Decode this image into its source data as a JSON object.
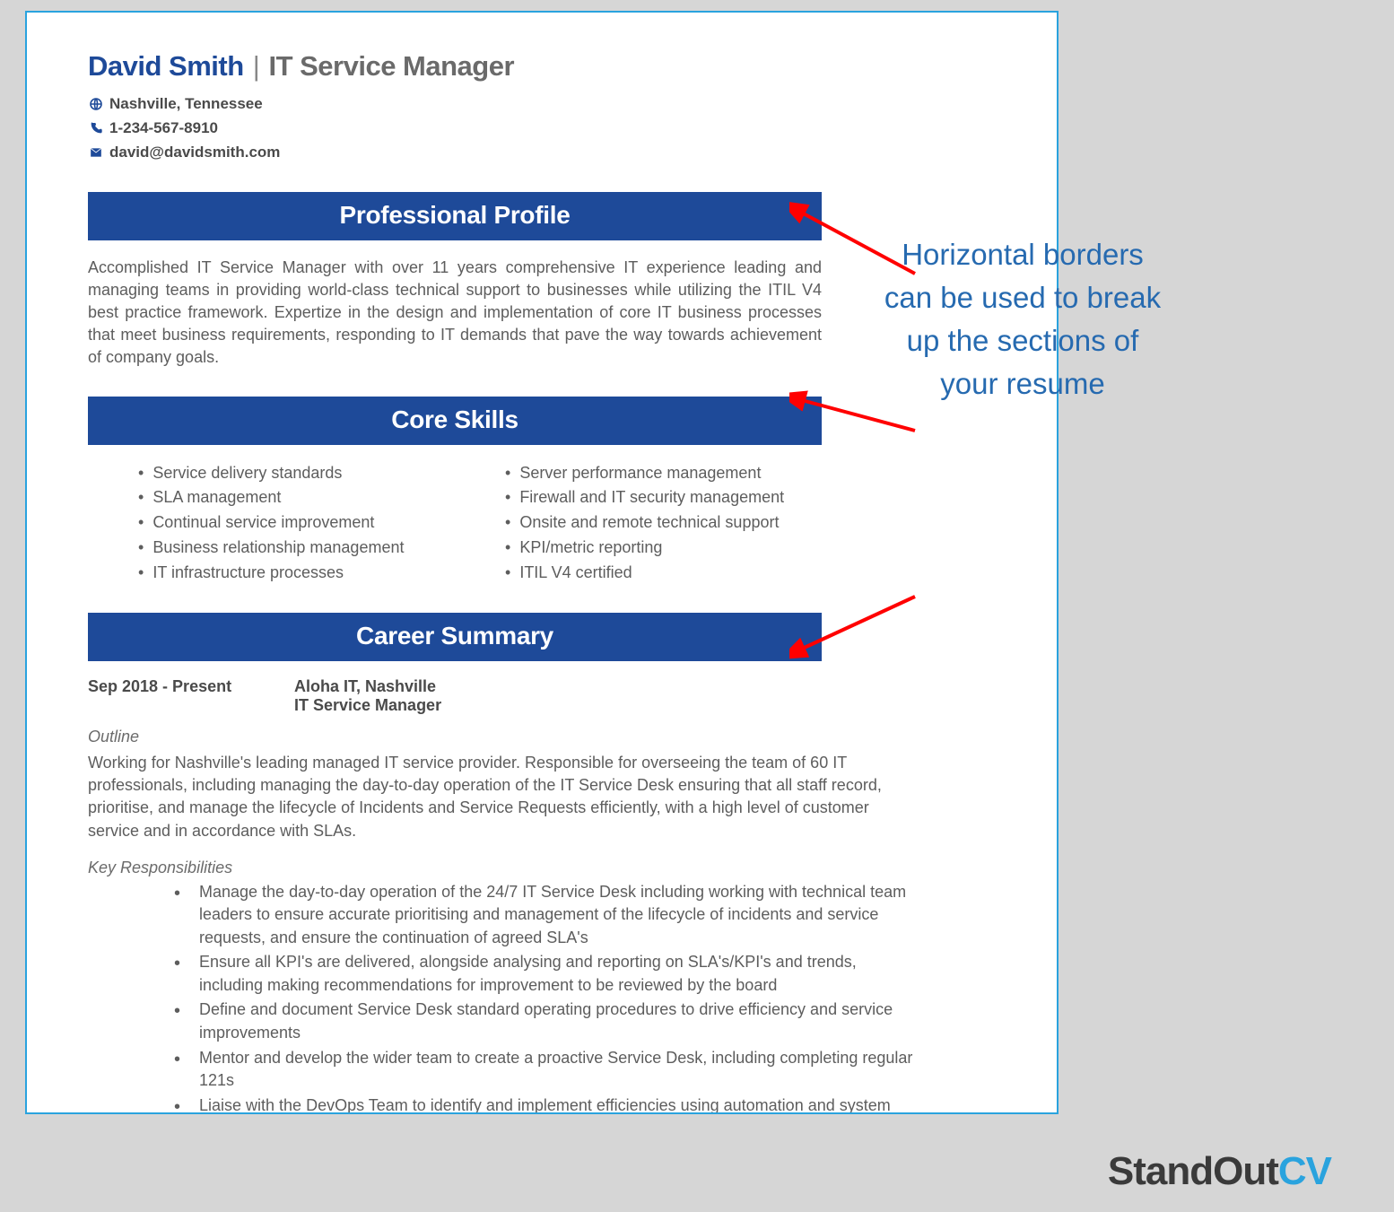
{
  "header": {
    "name": "David Smith",
    "title": "IT Service Manager",
    "location": "Nashville, Tennessee",
    "phone": "1-234-567-8910",
    "email": "david@davidsmith.com"
  },
  "sections": {
    "profile": {
      "title": "Professional Profile",
      "text": "Accomplished IT Service Manager with over 11 years comprehensive IT experience leading and managing teams in providing world-class technical support to businesses while utilizing the ITIL V4 best practice framework. Expertize in the design and implementation of core IT business processes that meet business requirements, responding to IT demands that pave the way towards achievement of company goals."
    },
    "skills": {
      "title": "Core Skills",
      "left": [
        "Service delivery standards",
        "SLA management",
        "Continual service improvement",
        "Business relationship management",
        "IT infrastructure processes"
      ],
      "right": [
        "Server performance management",
        "Firewall and IT security management",
        "Onsite and remote technical support",
        "KPI/metric reporting",
        "ITIL V4 certified"
      ]
    },
    "career": {
      "title": "Career Summary",
      "dates": "Sep 2018 - Present",
      "company": "Aloha IT, Nashville",
      "role": "IT Service Manager",
      "outline_label": "Outline",
      "outline_text": "Working for Nashville's leading managed IT service provider. Responsible for overseeing the team of 60 IT professionals, including managing the day-to-day operation of the IT Service Desk ensuring that all staff record, prioritise, and manage the lifecycle of Incidents and Service Requests efficiently, with a high level of customer service and in accordance with SLAs.",
      "kr_label": "Key Responsibilities",
      "kr_items": [
        "Manage the day-to-day operation of the 24/7 IT Service Desk including working with technical team leaders to ensure accurate prioritising and management of the lifecycle of incidents and service requests, and ensure the continuation of agreed SLA's",
        "Ensure all KPI's are delivered, alongside analysing and reporting on SLA's/KPI's and trends, including making recommendations for improvement to be reviewed by the board",
        "Define and document Service Desk standard operating procedures to drive efficiency and service improvements",
        "Mentor and develop the wider team to create a proactive Service Desk, including completing regular 121s",
        "Liaise with the DevOps Team to identify and implement efficiencies using automation and system improvements"
      ]
    }
  },
  "annotation": {
    "text": "Horizontal borders can be used to break up the sections of your resume"
  },
  "footer": {
    "brand1": "StandOut",
    "brand2": "CV"
  }
}
